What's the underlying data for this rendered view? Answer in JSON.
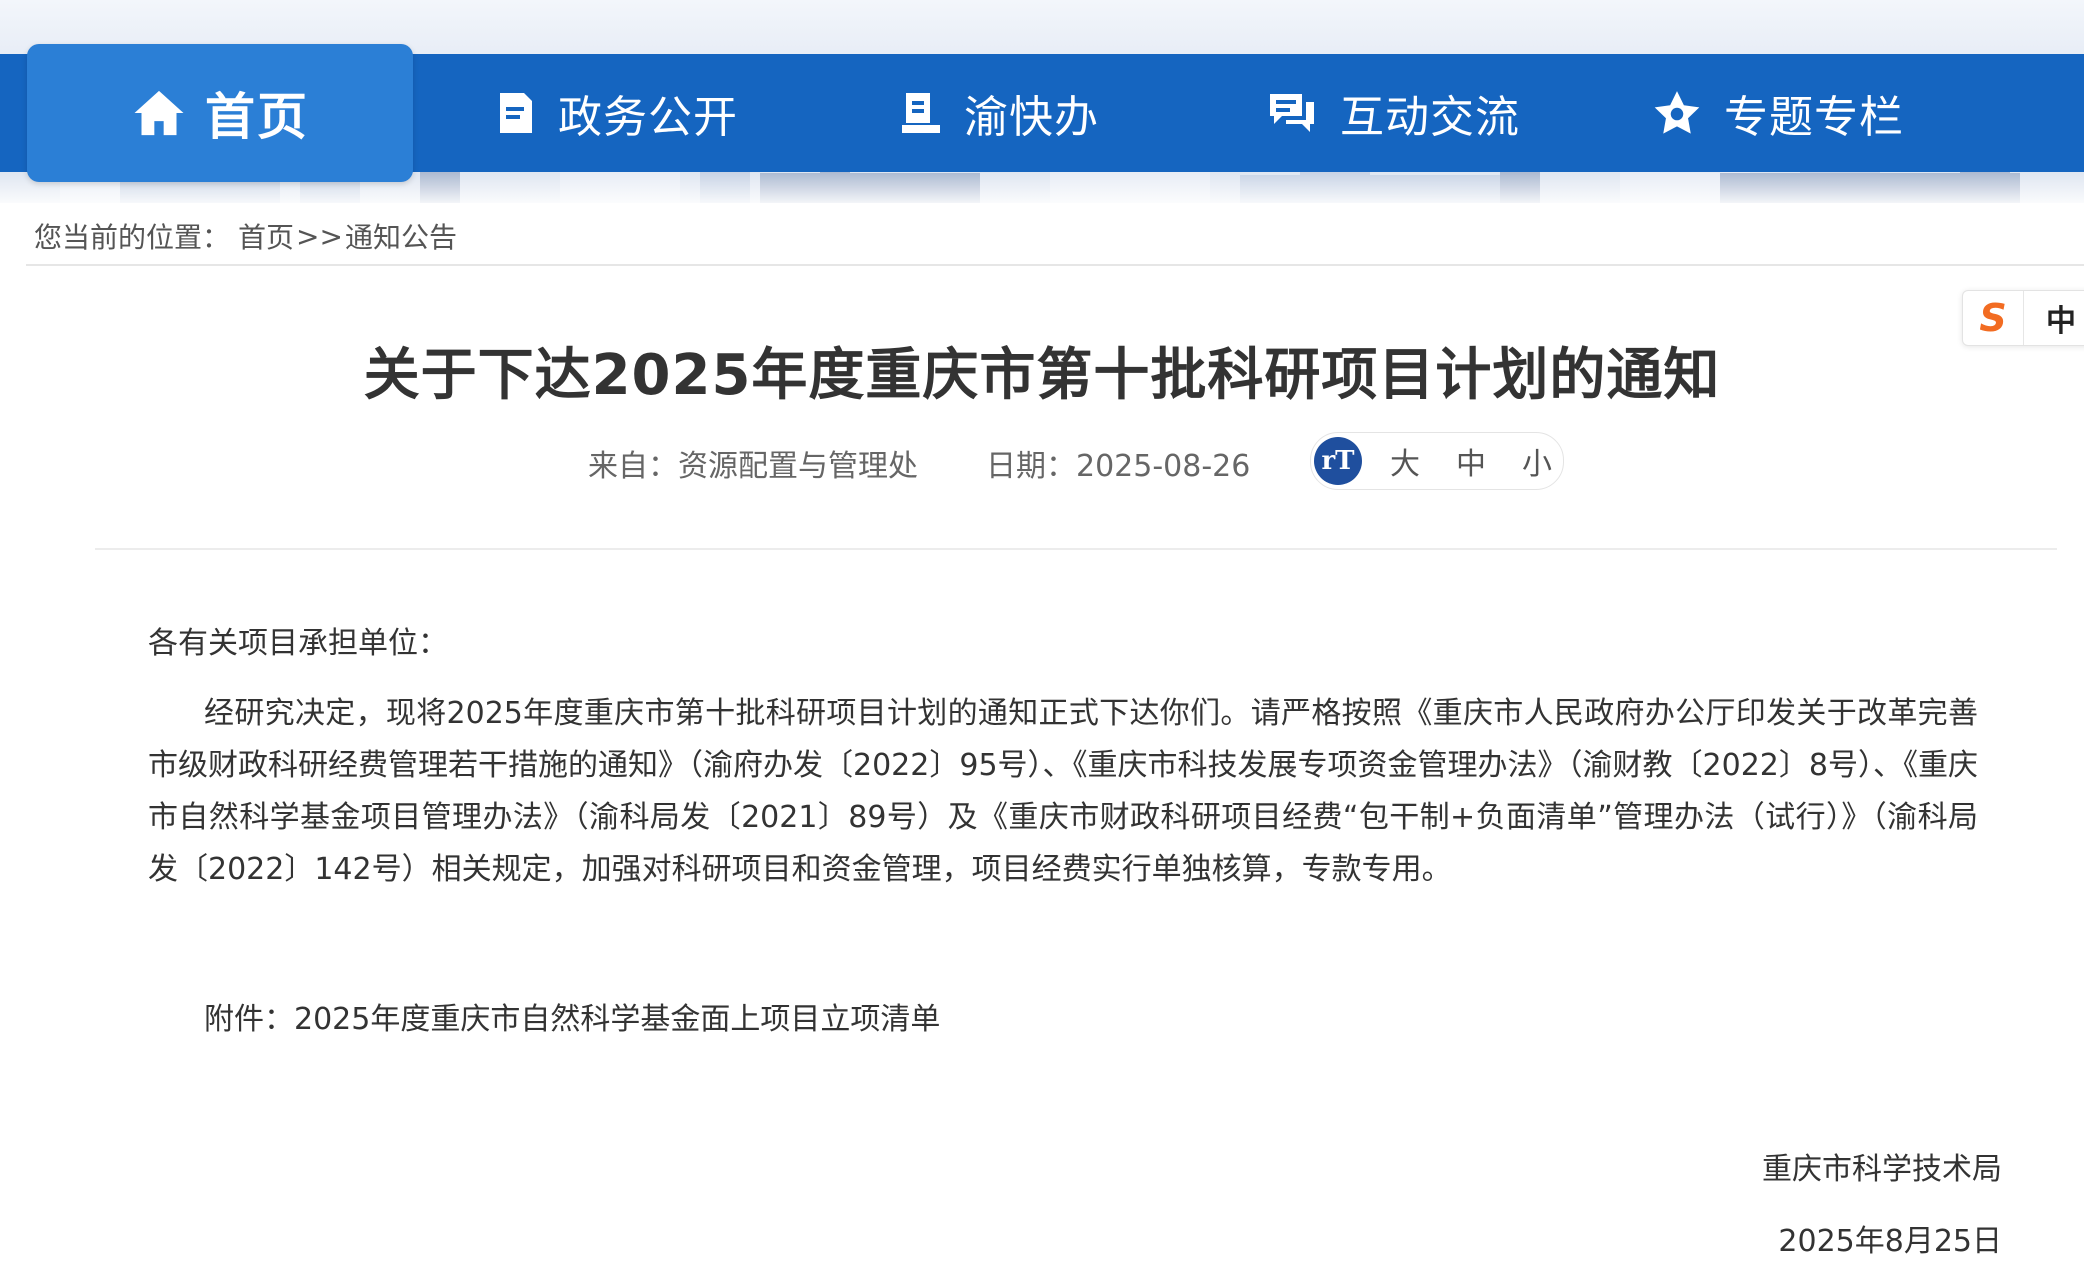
{
  "header": {
    "nav": [
      {
        "label": "首页",
        "icon": "home-icon"
      },
      {
        "label": "政务公开",
        "icon": "document-icon"
      },
      {
        "label": "渝快办",
        "icon": "service-book-icon"
      },
      {
        "label": "互动交流",
        "icon": "chat-icon"
      },
      {
        "label": "专题专栏",
        "icon": "star-icon"
      }
    ],
    "colors": {
      "nav_bg": "#1565c0",
      "active_bg": "#2b7fd6"
    }
  },
  "breadcrumb": {
    "prefix": "您当前的位置：",
    "home": "首页",
    "separator": ">>",
    "current": "通知公告"
  },
  "float_widget": {
    "logo": "S",
    "lang": "中"
  },
  "article": {
    "title": "关于下达2025年度重庆市第十批科研项目计划的通知",
    "source": "来自：资源配置与管理处",
    "date": "日期：2025-08-26",
    "font_size_options": [
      "大",
      "中",
      "小"
    ],
    "salutation": "各有关项目承担单位：",
    "body": "经研究决定，现将2025年度重庆市第十批科研项目计划的通知正式下达你们。请严格按照《重庆市人民政府办公厅印发关于改革完善市级财政科研经费管理若干措施的通知》（渝府办发〔2022〕95号）、《重庆市科技发展专项资金管理办法》（渝财教〔2022〕8号）、《重庆市自然科学基金项目管理办法》（渝科局发〔2021〕89号）及《重庆市财政科研项目经费“包干制+负面清单”管理办法（试行）》（渝科局发〔2022〕142号）相关规定，加强对科研项目和资金管理，项目经费实行单独核算，专款专用。",
    "attachment": "附件：2025年度重庆市自然科学基金面上项目立项清单",
    "signature": "重庆市科学技术局",
    "signature_date": "2025年8月25日"
  }
}
